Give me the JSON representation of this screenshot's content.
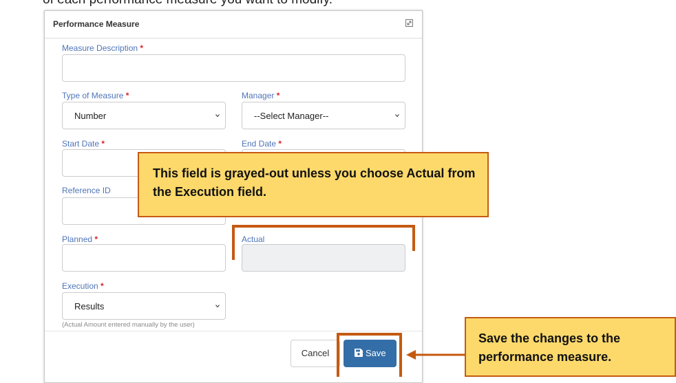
{
  "background_text": "of each performance measure you want to modify.",
  "modal": {
    "title": "Performance Measure",
    "required_mark": "*",
    "fields": {
      "measure_description": {
        "label": "Measure Description",
        "value": ""
      },
      "type_of_measure": {
        "label": "Type of Measure",
        "value": "Number"
      },
      "manager": {
        "label": "Manager",
        "value": "--Select Manager--"
      },
      "start_date": {
        "label": "Start Date",
        "value": ""
      },
      "end_date": {
        "label": "End Date",
        "value": ""
      },
      "reference_id": {
        "label": "Reference ID",
        "value": ""
      },
      "planned": {
        "label": "Planned",
        "value": ""
      },
      "actual": {
        "label": "Actual",
        "value": "",
        "disabled": true
      },
      "execution": {
        "label": "Execution",
        "value": "Results",
        "hint": "(Actual Amount entered manually by the user)"
      }
    },
    "buttons": {
      "cancel": "Cancel",
      "save": "Save"
    }
  },
  "callouts": {
    "actual_note": "This field is grayed-out unless you choose Actual from the Execution field.",
    "save_note": "Save the changes to the performance measure."
  },
  "colors": {
    "label_blue": "#4f74b8",
    "required_red": "#d9232b",
    "save_button": "#336ea8",
    "callout_fill": "#fdd96b",
    "callout_border": "#c55a11"
  }
}
